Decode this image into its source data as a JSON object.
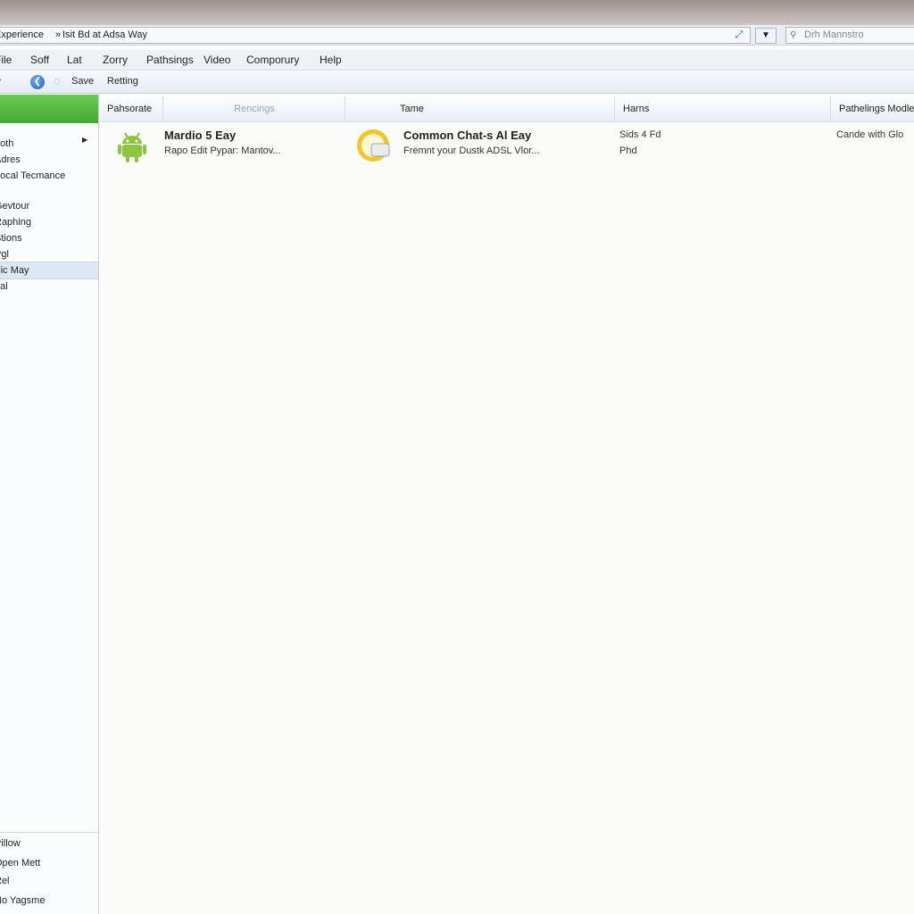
{
  "address": {
    "path": "Experience",
    "separator": "»",
    "location": "Isit Bd at Adsa Way",
    "refresh_icon": "refresh-icon",
    "dropdown_icon": "chevron-down-icon",
    "search_placeholder": "Drh Mannstro"
  },
  "menu": [
    "File",
    "Soff",
    "Lat",
    "Zorry",
    "Pathsings",
    "Video",
    "Comporury",
    "Help"
  ],
  "toolbar": {
    "save_label": "Save",
    "settings_label": "Retting"
  },
  "sidebar": {
    "items": [
      "Loth",
      "Adres",
      "Local Tecmance",
      "Gevtour",
      "Raphing",
      "Stions",
      "Pgl",
      "Fic May",
      "Ital"
    ],
    "selected_index": 7,
    "bottom_items": [
      "Pillow",
      "Open Mett",
      "Rel",
      "No Yagsme"
    ]
  },
  "columns": [
    "Pahsorate",
    "Rencings",
    "Tame",
    "Harns",
    "Pathelings Modle"
  ],
  "rows": [
    {
      "icon": "android-icon",
      "title": "Mardio 5 Eay",
      "subtitle": "Rapo Edit Pypar: Mantov...",
      "icon2": "chat-bubble-icon",
      "title2": "Common Chat-s Al Eay",
      "subtitle2": "Fremnt your Dustk ADSL Vlor...",
      "harns_line1": "Sids 4 Fd",
      "harns_line2": "Phd",
      "modle": "Cande with Glo"
    }
  ],
  "colors": {
    "accent_green": "#4caf37",
    "selection_blue": "#dde8f5"
  }
}
